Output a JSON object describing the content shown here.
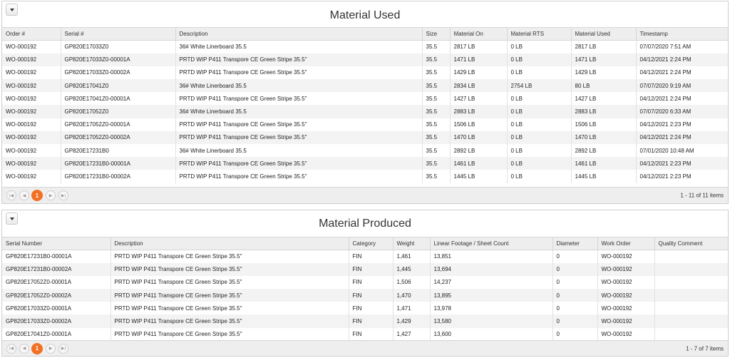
{
  "material_used": {
    "title": "Material Used",
    "columns": [
      "Order #",
      "Serial #",
      "Description",
      "Size",
      "Material On",
      "Material RTS",
      "Material Used",
      "Timestamp"
    ],
    "rows": [
      [
        "WO-000192",
        "GP820E17033Z0",
        "36# White Linerboard 35.5",
        "35.5",
        "2817 LB",
        "0 LB",
        "2817 LB",
        "07/07/2020 7:51 AM"
      ],
      [
        "WO-000192",
        "GP820E17033Z0-00001A",
        " PRTD WIP P411 Transpore CE Green Stripe 35.5\"",
        "35.5",
        "1471 LB",
        "0 LB",
        "1471 LB",
        "04/12/2021 2:24 PM"
      ],
      [
        "WO-000192",
        "GP820E17033Z0-00002A",
        " PRTD WIP P411 Transpore CE Green Stripe 35.5\"",
        "35.5",
        "1429 LB",
        "0 LB",
        "1429 LB",
        "04/12/2021 2:24 PM"
      ],
      [
        "WO-000192",
        "GP820E17041Z0",
        "36# White Linerboard 35.5",
        "35.5",
        "2834 LB",
        "2754 LB",
        "80 LB",
        "07/07/2020 9:19 AM"
      ],
      [
        "WO-000192",
        "GP820E17041Z0-00001A",
        " PRTD WIP P411 Transpore CE Green Stripe 35.5\"",
        "35.5",
        "1427 LB",
        "0 LB",
        "1427 LB",
        "04/12/2021 2:24 PM"
      ],
      [
        "WO-000192",
        "GP820E17052Z0",
        "36# White Linerboard 35.5",
        "35.5",
        "2883 LB",
        "0 LB",
        "2883 LB",
        "07/07/2020 6:33 AM"
      ],
      [
        "WO-000192",
        "GP820E17052Z0-00001A",
        " PRTD WIP P411 Transpore CE Green Stripe 35.5\"",
        "35.5",
        "1506 LB",
        "0 LB",
        "1506 LB",
        "04/12/2021 2:23 PM"
      ],
      [
        "WO-000192",
        "GP820E17052Z0-00002A",
        " PRTD WIP P411 Transpore CE Green Stripe 35.5\"",
        "35.5",
        "1470 LB",
        "0 LB",
        "1470 LB",
        "04/12/2021 2:24 PM"
      ],
      [
        "WO-000192",
        "GP820E17231B0",
        "36# White Linerboard 35.5",
        "35.5",
        "2892 LB",
        "0 LB",
        "2892 LB",
        "07/01/2020 10:48 AM"
      ],
      [
        "WO-000192",
        "GP820E17231B0-00001A",
        " PRTD WIP P411 Transpore CE Green Stripe 35.5\"",
        "35.5",
        "1461 LB",
        "0 LB",
        "1461 LB",
        "04/12/2021 2:23 PM"
      ],
      [
        "WO-000192",
        "GP820E17231B0-00002A",
        " PRTD WIP P411 Transpore CE Green Stripe 35.5\"",
        "35.5",
        "1445 LB",
        "0 LB",
        "1445 LB",
        "04/12/2021 2:23 PM"
      ]
    ],
    "pager": {
      "current_page": "1",
      "info": "1 - 11 of 11 items"
    }
  },
  "material_produced": {
    "title": "Material Produced",
    "columns": [
      "Serial Number",
      "Description",
      "Category",
      "Weight",
      "Linear Footage / Sheet Count",
      "Diameter",
      "Work Order",
      "Quality Comment"
    ],
    "rows": [
      [
        "GP820E17231B0-00001A",
        "PRTD WIP P411 Transpore CE Green Stripe 35.5\"",
        "FIN",
        "1,461",
        "13,851",
        "0",
        "WO-000192",
        ""
      ],
      [
        "GP820E17231B0-00002A",
        "PRTD WIP P411 Transpore CE Green Stripe 35.5\"",
        "FIN",
        "1,445",
        "13,694",
        "0",
        "WO-000192",
        ""
      ],
      [
        "GP820E17052Z0-00001A",
        "PRTD WIP P411 Transpore CE Green Stripe 35.5\"",
        "FIN",
        "1,506",
        "14,237",
        "0",
        "WO-000192",
        ""
      ],
      [
        "GP820E17052Z0-00002A",
        "PRTD WIP P411 Transpore CE Green Stripe 35.5\"",
        "FIN",
        "1,470",
        "13,895",
        "0",
        "WO-000192",
        ""
      ],
      [
        "GP820E17033Z0-00001A",
        "PRTD WIP P411 Transpore CE Green Stripe 35.5\"",
        "FIN",
        "1,471",
        "13,978",
        "0",
        "WO-000192",
        ""
      ],
      [
        "GP820E17033Z0-00002A",
        "PRTD WIP P411 Transpore CE Green Stripe 35.5\"",
        "FIN",
        "1,429",
        "13,580",
        "0",
        "WO-000192",
        ""
      ],
      [
        "GP820E17041Z0-00001A",
        "PRTD WIP P411 Transpore CE Green Stripe 35.5\"",
        "FIN",
        "1,427",
        "13,600",
        "0",
        "WO-000192",
        ""
      ]
    ],
    "pager": {
      "current_page": "1",
      "info": "1 - 7 of 7 items"
    }
  },
  "icons": {
    "dropdown": "chevron-down-icon",
    "first": "first-page-icon",
    "prev": "prev-page-icon",
    "next": "next-page-icon",
    "last": "last-page-icon"
  },
  "colors": {
    "accent": "#f36f21",
    "header_bg": "#eeeeee",
    "alt_row": "#f3f3f3"
  }
}
